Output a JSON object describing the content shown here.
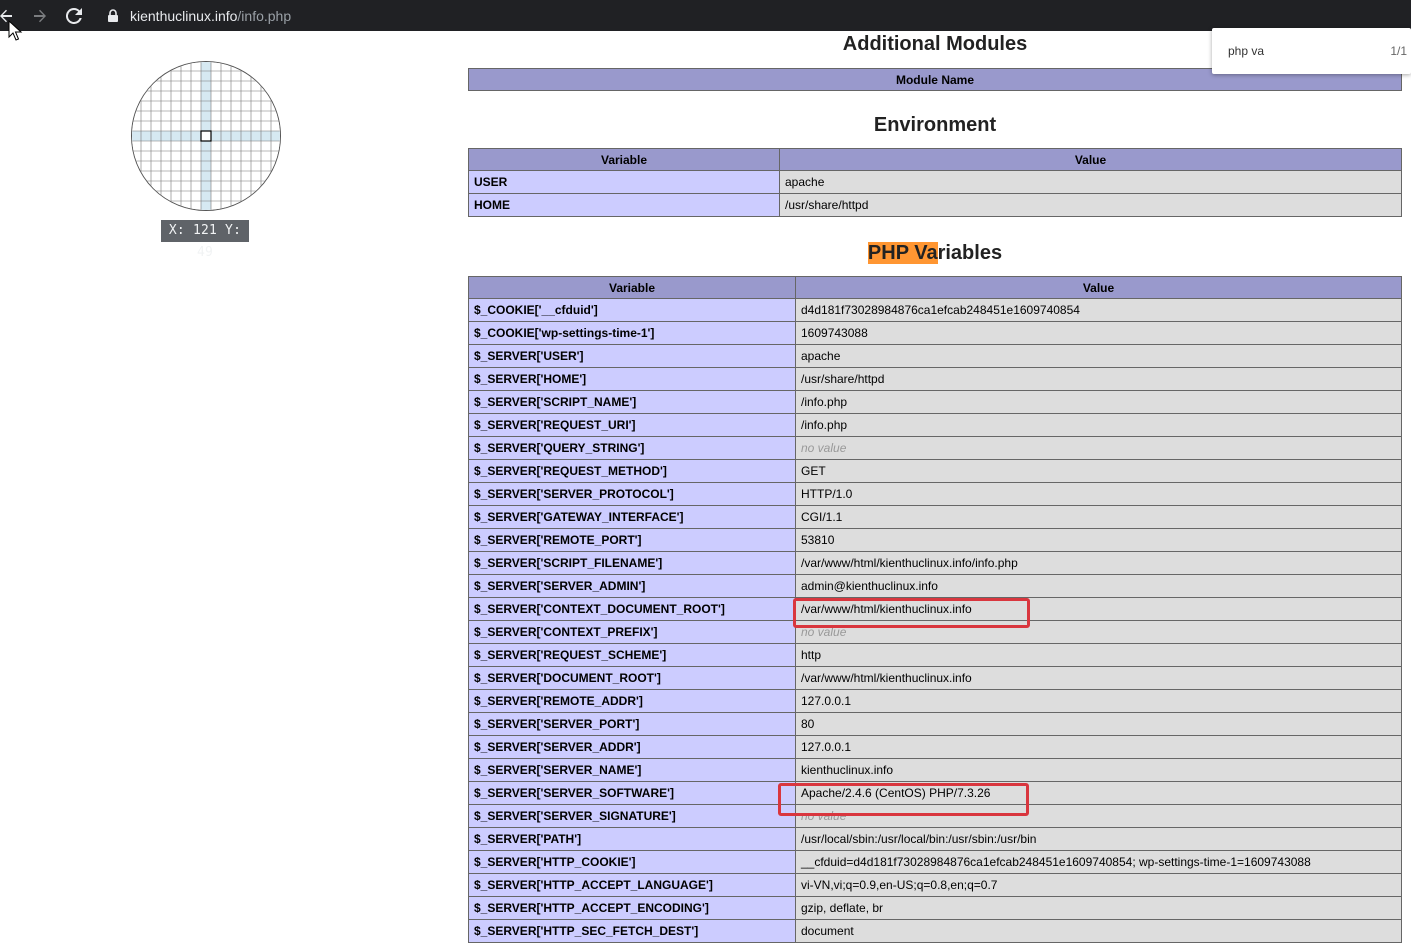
{
  "browser": {
    "url_domain": "kienthuclinux.info",
    "url_path": "/info.php",
    "back_icon": "arrow-left-icon",
    "forward_icon": "arrow-right-icon",
    "reload_icon": "reload-icon",
    "lock_icon": "lock-icon"
  },
  "find_bar": {
    "query": "php va",
    "count": "1/1"
  },
  "magnifier": {
    "coords": "X: 121 Y: 49"
  },
  "sections": {
    "modules": {
      "title": "Additional Modules",
      "header": "Module Name"
    },
    "environment": {
      "title": "Environment",
      "col_variable": "Variable",
      "col_value": "Value",
      "rows": [
        {
          "name": "USER",
          "value": "apache"
        },
        {
          "name": "HOME",
          "value": "/usr/share/httpd"
        }
      ]
    },
    "php_variables": {
      "title_highlight": "PHP Va",
      "title_rest": "riables",
      "col_variable": "Variable",
      "col_value": "Value",
      "rows": [
        {
          "name": "$_COOKIE['__cfduid']",
          "value": "d4d181f73028984876ca1efcab248451e1609740854"
        },
        {
          "name": "$_COOKIE['wp-settings-time-1']",
          "value": "1609743088"
        },
        {
          "name": "$_SERVER['USER']",
          "value": "apache"
        },
        {
          "name": "$_SERVER['HOME']",
          "value": "/usr/share/httpd"
        },
        {
          "name": "$_SERVER['SCRIPT_NAME']",
          "value": "/info.php"
        },
        {
          "name": "$_SERVER['REQUEST_URI']",
          "value": "/info.php"
        },
        {
          "name": "$_SERVER['QUERY_STRING']",
          "value": "no value"
        },
        {
          "name": "$_SERVER['REQUEST_METHOD']",
          "value": "GET"
        },
        {
          "name": "$_SERVER['SERVER_PROTOCOL']",
          "value": "HTTP/1.0"
        },
        {
          "name": "$_SERVER['GATEWAY_INTERFACE']",
          "value": "CGI/1.1"
        },
        {
          "name": "$_SERVER['REMOTE_PORT']",
          "value": "53810"
        },
        {
          "name": "$_SERVER['SCRIPT_FILENAME']",
          "value": "/var/www/html/kienthuclinux.info/info.php"
        },
        {
          "name": "$_SERVER['SERVER_ADMIN']",
          "value": "admin@kienthuclinux.info"
        },
        {
          "name": "$_SERVER['CONTEXT_DOCUMENT_ROOT']",
          "value": "/var/www/html/kienthuclinux.info"
        },
        {
          "name": "$_SERVER['CONTEXT_PREFIX']",
          "value": "no value"
        },
        {
          "name": "$_SERVER['REQUEST_SCHEME']",
          "value": "http"
        },
        {
          "name": "$_SERVER['DOCUMENT_ROOT']",
          "value": "/var/www/html/kienthuclinux.info"
        },
        {
          "name": "$_SERVER['REMOTE_ADDR']",
          "value": "127.0.0.1"
        },
        {
          "name": "$_SERVER['SERVER_PORT']",
          "value": "80"
        },
        {
          "name": "$_SERVER['SERVER_ADDR']",
          "value": "127.0.0.1"
        },
        {
          "name": "$_SERVER['SERVER_NAME']",
          "value": "kienthuclinux.info"
        },
        {
          "name": "$_SERVER['SERVER_SOFTWARE']",
          "value": "Apache/2.4.6 (CentOS) PHP/7.3.26"
        },
        {
          "name": "$_SERVER['SERVER_SIGNATURE']",
          "value": "no value"
        },
        {
          "name": "$_SERVER['PATH']",
          "value": "/usr/local/sbin:/usr/local/bin:/usr/sbin:/usr/bin"
        },
        {
          "name": "$_SERVER['HTTP_COOKIE']",
          "value": "__cfduid=d4d181f73028984876ca1efcab248451e1609740854; wp-settings-time-1=1609743088"
        },
        {
          "name": "$_SERVER['HTTP_ACCEPT_LANGUAGE']",
          "value": "vi-VN,vi;q=0.9,en-US;q=0.8,en;q=0.7"
        },
        {
          "name": "$_SERVER['HTTP_ACCEPT_ENCODING']",
          "value": "gzip, deflate, br"
        },
        {
          "name": "$_SERVER['HTTP_SEC_FETCH_DEST']",
          "value": "document"
        }
      ]
    }
  },
  "colors": {
    "header_bg": "#9999cc",
    "name_cell_bg": "#ccccff",
    "value_cell_bg": "#dddddd",
    "find_highlight": "#ff9632",
    "annotation_red": "#d9363e"
  }
}
